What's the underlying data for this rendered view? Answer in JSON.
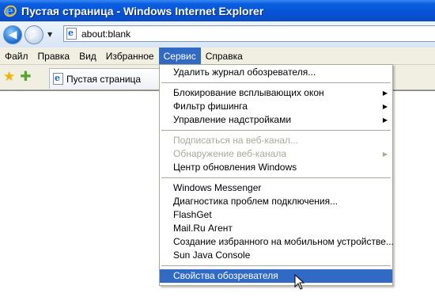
{
  "window": {
    "title": "Пустая страница - Windows Internet Explorer"
  },
  "address_bar": {
    "url": "about:blank"
  },
  "menu_bar": {
    "items": [
      "Файл",
      "Правка",
      "Вид",
      "Избранное",
      "Сервис",
      "Справка"
    ],
    "active": "Сервис"
  },
  "tab": {
    "label": "Пустая страница"
  },
  "tools_menu": {
    "groups": [
      [
        {
          "label": "Удалить журнал обозревателя...",
          "enabled": true,
          "submenu": false
        }
      ],
      [
        {
          "label": "Блокирование всплывающих окон",
          "enabled": true,
          "submenu": true
        },
        {
          "label": "Фильтр фишинга",
          "enabled": true,
          "submenu": true
        },
        {
          "label": "Управление надстройками",
          "enabled": true,
          "submenu": true
        }
      ],
      [
        {
          "label": "Подписаться на веб-канал...",
          "enabled": false,
          "submenu": false
        },
        {
          "label": "Обнаружение веб-канала",
          "enabled": false,
          "submenu": true
        },
        {
          "label": "Центр обновления Windows",
          "enabled": true,
          "submenu": false
        }
      ],
      [
        {
          "label": "Windows Messenger",
          "enabled": true,
          "submenu": false
        },
        {
          "label": "Диагностика проблем подключения...",
          "enabled": true,
          "submenu": false
        },
        {
          "label": "FlashGet",
          "enabled": true,
          "submenu": false
        },
        {
          "label": "Mail.Ru Агент",
          "enabled": true,
          "submenu": false
        },
        {
          "label": "Создание избранного на мобильном устройстве...",
          "enabled": true,
          "submenu": false
        },
        {
          "label": "Sun Java Console",
          "enabled": true,
          "submenu": false
        }
      ],
      [
        {
          "label": "Свойства обозревателя",
          "enabled": true,
          "submenu": false,
          "highlighted": true
        }
      ]
    ]
  },
  "colors": {
    "selection": "#316ac5",
    "titlebar": "#0752d6",
    "disabled_text": "#aca899"
  }
}
